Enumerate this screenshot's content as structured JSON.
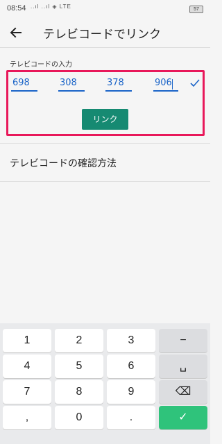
{
  "status": {
    "time": "08:54",
    "signal": "..ıl ..ıl ◈ LTE",
    "battery": "57"
  },
  "header": {
    "title": "テレビコードでリンク"
  },
  "code_entry": {
    "label": "テレビコードの入力",
    "fields": [
      "698",
      "308",
      "378",
      "906"
    ],
    "link_label": "リンク"
  },
  "help": {
    "how_to_label": "テレビコードの確認方法"
  },
  "keyboard": {
    "rows": [
      [
        "1",
        "2",
        "3",
        "−"
      ],
      [
        "4",
        "5",
        "6",
        "␣"
      ],
      [
        "7",
        "8",
        "9",
        "⌫"
      ],
      [
        ",",
        "0",
        ".",
        "✓"
      ]
    ]
  },
  "colors": {
    "accent": "#1a64c8",
    "button": "#168a72",
    "highlight": "#e8185a",
    "confirm": "#2fc37b"
  }
}
